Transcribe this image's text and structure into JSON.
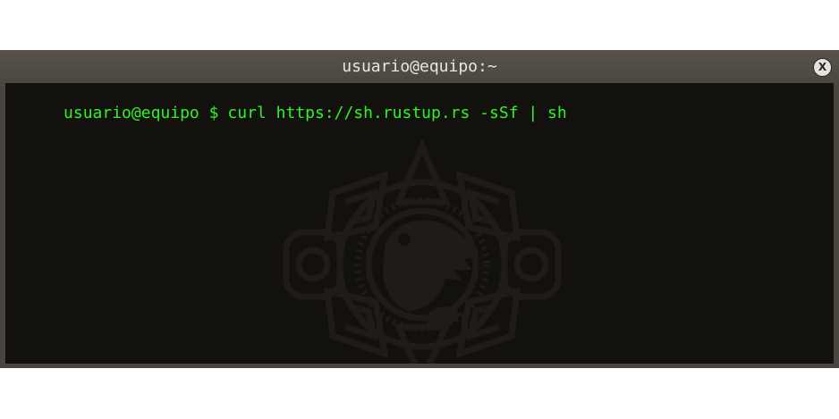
{
  "window": {
    "title": "usuario@equipo:~",
    "close_label": "X"
  },
  "terminal": {
    "prompt": "usuario@equipo $",
    "command": "curl https://sh.rustup.rs -sSf | sh",
    "text_color": "#2df42a",
    "background_color": "#13110d"
  },
  "icons": {
    "background_watermark": "aztec-sun-stone-icon"
  }
}
